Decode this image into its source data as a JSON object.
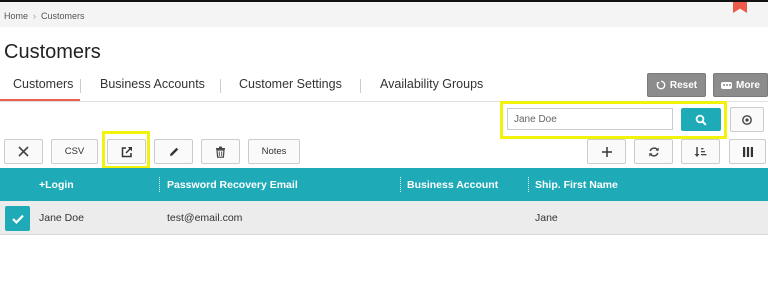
{
  "breadcrumb": {
    "home": "Home",
    "current": "Customers"
  },
  "page": {
    "title": "Customers"
  },
  "tabs": [
    {
      "label": "Customers"
    },
    {
      "label": "Business Accounts"
    },
    {
      "label": "Customer Settings"
    },
    {
      "label": "Availability Groups"
    }
  ],
  "actions": {
    "reset_label": "Reset",
    "more_label": "More"
  },
  "search": {
    "value": "Jane Doe",
    "placeholder": "Search"
  },
  "toolbar": {
    "csv_label": "CSV",
    "notes_label": "Notes"
  },
  "grid": {
    "columns": [
      "+Login",
      "Password Recovery Email",
      "Business Account",
      "Ship. First Name"
    ],
    "rows": [
      {
        "login": "Jane Doe",
        "email": "test@email.com",
        "business_account": "",
        "ship_first_name": "Jane"
      }
    ]
  },
  "colors": {
    "accent": "#1faab8",
    "active_tab": "#e8604c",
    "highlight": "#f2f20a",
    "grey_button": "#8c8c8c"
  },
  "icons": [
    "chevron-right-icon",
    "bookmark-icon",
    "reset-icon",
    "ellipsis-icon",
    "search-icon",
    "target-icon",
    "close-icon",
    "export-icon",
    "pencil-icon",
    "trash-icon",
    "plus-icon",
    "refresh-icon",
    "sort-icon",
    "columns-icon",
    "check-icon"
  ]
}
